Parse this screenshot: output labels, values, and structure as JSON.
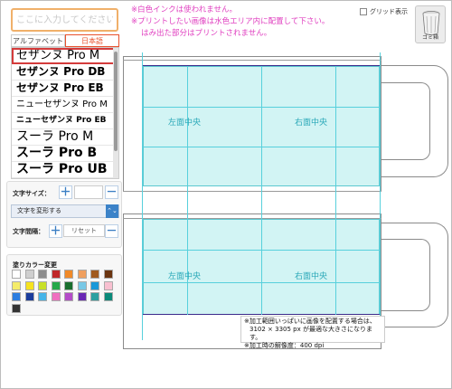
{
  "text_input": {
    "placeholder": "ここに入力してください"
  },
  "tabs": {
    "alphabet": "アルファベット",
    "japanese": "日本語"
  },
  "fonts": [
    {
      "label": "セザンヌ Pro M",
      "size": 13,
      "weight": "500",
      "selected": true
    },
    {
      "label": "セザンヌ Pro DB",
      "size": 12,
      "weight": "600",
      "selected": false
    },
    {
      "label": "セザンヌ Pro EB",
      "size": 12,
      "weight": "800",
      "selected": false
    },
    {
      "label": "ニューセザンヌ Pro M",
      "size": 10,
      "weight": "400",
      "selected": false
    },
    {
      "label": "ニューセザンヌ Pro EB",
      "size": 9,
      "weight": "800",
      "selected": false
    },
    {
      "label": "スーラ Pro M",
      "size": 14,
      "weight": "400",
      "selected": false
    },
    {
      "label": "スーラ Pro B",
      "size": 14,
      "weight": "700",
      "selected": false
    },
    {
      "label": "スーラ Pro UB",
      "size": 14,
      "weight": "900",
      "selected": false
    }
  ],
  "font_size": {
    "label": "文字サイズ：",
    "plus": "＋",
    "minus": "－"
  },
  "transform": {
    "label": "文字を変形する",
    "arrow": "⌃⌄"
  },
  "spacing": {
    "label": "文字間隔：",
    "plus": "＋",
    "reset": "リセット",
    "minus": "－"
  },
  "palette": {
    "title": "塗りカラー変更",
    "colors": [
      "#ffffff",
      "#cfcfcf",
      "#8c8c8c",
      "#c0282a",
      "#f08a28",
      "#f0a060",
      "#a05a1e",
      "#6a3410",
      "#f4ec6a",
      "#f6e21e",
      "#c8e028",
      "#26a84a",
      "#1a6e2e",
      "#78c8e6",
      "#1a98d8",
      "#f8c0d0",
      "#2c7de0",
      "#1a3c9c",
      "#46b4e8",
      "#f070c0",
      "#b44cc8",
      "#6a28b4",
      "#2ca0a0",
      "#0a8a7a",
      "#333333"
    ]
  },
  "notices": {
    "line1": "※白色インクは使われません。",
    "line2": "※プリントしたい画像は水色エリア内に配置して下さい。",
    "line3": "はみ出た部分はプリントされません。"
  },
  "grid_toggle": {
    "label": "グリッド表示"
  },
  "trash": {
    "label": "ゴミ箱",
    "icon": "trash-can-icon"
  },
  "canvas": {
    "left_face_label": "左面中央",
    "right_face_label": "右面中央"
  },
  "spec": {
    "line1": "※加工範囲いっぱいに画像を配置する場合は、",
    "line2": "3102 × 3305 px が最適な大きさになります。",
    "line3": "※加工時の解像度：400 dpi"
  },
  "colors": {
    "accent": "#e8512c",
    "notice": "#e040c0",
    "print_area": "#d2f4f4",
    "guide": "#57d0dc"
  }
}
